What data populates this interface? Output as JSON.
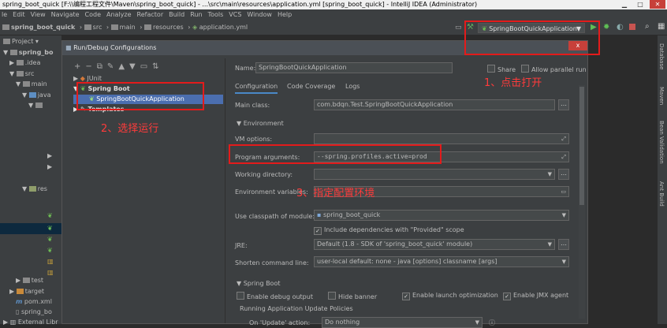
{
  "window": {
    "title": "spring_boot_quick [F:\\\\编程工程文件\\Maven\\spring_boot_quick] - ...\\src\\main\\resources\\application.yml [spring_boot_quick] - IntelliJ IDEA (Administrator)",
    "min": "▁",
    "max": "□",
    "close": "✕"
  },
  "menu": [
    "le",
    "Edit",
    "View",
    "Navigate",
    "Code",
    "Analyze",
    "Refactor",
    "Build",
    "Run",
    "Tools",
    "VCS",
    "Window",
    "Help"
  ],
  "breadcrumb": [
    "spring_boot_quick",
    "src",
    "main",
    "resources",
    "application.yml"
  ],
  "run_config_selector": "SpringBootQuickApplication",
  "project_panel": {
    "header": "Project",
    "items": [
      "spring_bo",
      ".idea",
      "src",
      "main",
      "java",
      "res",
      "test",
      "target",
      "pom.xml",
      "spring_bo",
      "External Libr"
    ]
  },
  "right_tabs": [
    "Database",
    "Maven",
    "Bean Validation",
    "Ant Build"
  ],
  "dialog": {
    "title": "Run/Debug Configurations",
    "close": "x",
    "tree": {
      "junit": "JUnit",
      "spring_boot": "Spring Boot",
      "app": "SpringBootQuickApplication",
      "templates": "Templates"
    },
    "name_label": "Name:",
    "name_value": "SpringBootQuickApplication",
    "share": "Share",
    "allow_parallel": "Allow parallel run",
    "tabs": [
      "Configuration",
      "Code Coverage",
      "Logs"
    ],
    "main_class_label": "Main class:",
    "main_class_value": "com.bdqn.Test.SpringBootQuickApplication",
    "environment_label": "Environment",
    "vm_options_label": "VM options:",
    "program_args_label": "Program arguments:",
    "program_args_value": "--spring.profiles.active=prod",
    "working_dir_label": "Working directory:",
    "env_vars_label": "Environment variables:",
    "classpath_label": "Use classpath of module:",
    "classpath_value": "spring_boot_quick",
    "include_deps": "Include dependencies with \"Provided\" scope",
    "jre_label": "JRE:",
    "jre_value": "Default (1.8 - SDK of 'spring_boot_quick' module)",
    "shorten_label": "Shorten command line:",
    "shorten_value": "user-local default: none - java [options] classname [args]",
    "spring_boot_section": "Spring Boot",
    "enable_debug": "Enable debug output",
    "hide_banner": "Hide banner",
    "enable_launch": "Enable launch optimization",
    "enable_jmx": "Enable JMX agent",
    "update_policies": "Running Application Update Policies",
    "on_update_label": "On 'Update' action:",
    "on_update_value": "Do nothing"
  },
  "annotations": {
    "step1": "1、点击打开",
    "step2": "2、选择运行",
    "step3": "3、指定配置环境"
  },
  "colors": {
    "annotation": "#e31b1b",
    "selection": "#4b6eaf",
    "background": "#3c3f41"
  }
}
